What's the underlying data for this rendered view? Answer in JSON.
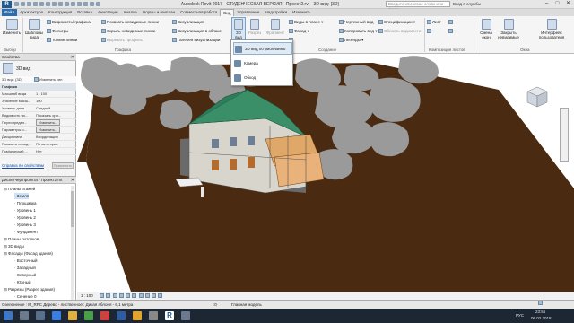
{
  "titlebar": {
    "logo": "R",
    "title": "Autodesk Revit 2017 - СТУДЕНЧЕСКАЯ ВЕРСИЯ -  Проект2.rvt - 3D вид: {3D}",
    "search_placeholder": "Введите ключевое слово или фразу",
    "user": "Вход в службы"
  },
  "tabs": [
    "Файл",
    "Архитектура",
    "Конструкция",
    "Вставка",
    "Аннотации",
    "Анализ",
    "Формы и генплан",
    "Совместная работа",
    "Вид",
    "Управление",
    "Надстройки",
    "Изменить"
  ],
  "active_tab": "Вид",
  "ribbon": {
    "modify": "Изменить",
    "filters": "Шаблоны вида",
    "visibility": "Видимость/ графика",
    "filters_btn": "Фильтры",
    "thin_lines": "Тонкие линии",
    "show_hidden": "Показать невидимые линии",
    "hide_hidden": "Скрыть невидимые линии",
    "cut_profile": "Вырезать профиль",
    "render": "Визуализация",
    "render_cloud": "Визуализация в облаке",
    "render_gallery": "Галерея визуализации",
    "view3d": "3D вид",
    "section": "Разрез",
    "callout": "Фрагмент",
    "plan_views": "Виды в плане",
    "elevation": "Фасад",
    "duplicate": "Копировать вид",
    "legends": "Легенды",
    "drafting": "Чертежный вид",
    "schedules": "Спецификации",
    "scope_box": "Область видимости",
    "sheet": "Лист",
    "title_block": "Основная надпись",
    "switch_windows": "Смена окон",
    "close_hidden": "Закрыть невидимые",
    "ui": "Интерфейс пользователя",
    "panel_select": "Выбор",
    "panel_graphics": "Графика",
    "panel_create": "Создание",
    "panel_sheets": "Композиция листов",
    "panel_windows": "Окна"
  },
  "dropdown": {
    "items": [
      "3D вид по умолчанию",
      "Камера",
      "Обход"
    ]
  },
  "properties": {
    "header": "Свойства",
    "type_name": "3D вид",
    "selector": "3D вид: {3D}",
    "edit_type": "Изменить тип",
    "section": "Графика",
    "rows": [
      {
        "k": "Масштаб вида",
        "v": "1 : 100"
      },
      {
        "k": "Значение масш...",
        "v": "100"
      },
      {
        "k": "Уровень дета...",
        "v": "Средний"
      },
      {
        "k": "Видимость ча...",
        "v": "Показать ори..."
      },
      {
        "k": "Переопредел...",
        "v": "Изменить..."
      },
      {
        "k": "Параметры о...",
        "v": "Изменить..."
      },
      {
        "k": "Дисциплина",
        "v": "Координация"
      },
      {
        "k": "Показать невид...",
        "v": "По категории"
      },
      {
        "k": "Графический ...",
        "v": "Нет"
      }
    ],
    "help_link": "Справка по свойствам",
    "apply": "Применить"
  },
  "browser": {
    "header": "Диспетчер проекта - Проект2.rvt",
    "nodes": [
      {
        "label": "Планы этажей",
        "level": 1
      },
      {
        "label": "Земля",
        "level": 2,
        "selected": true
      },
      {
        "label": "Площадка",
        "level": 2
      },
      {
        "label": "Уровень 1",
        "level": 2
      },
      {
        "label": "Уровень 2",
        "level": 2
      },
      {
        "label": "Уровень 3",
        "level": 2
      },
      {
        "label": "Фундамент",
        "level": 2
      },
      {
        "label": "Планы потолков",
        "level": 1
      },
      {
        "label": "3D виды",
        "level": 1
      },
      {
        "label": "Фасады (Фасад здания)",
        "level": 1
      },
      {
        "label": "Восточный",
        "level": 2
      },
      {
        "label": "Западный",
        "level": 2
      },
      {
        "label": "Северный",
        "level": 2
      },
      {
        "label": "Южный",
        "level": 2
      },
      {
        "label": "Разрезы (Разрез здания)",
        "level": 1
      },
      {
        "label": "Сечение 0",
        "level": 2
      }
    ]
  },
  "viewbar": {
    "scale": "1 : 100"
  },
  "statusbar": {
    "left": "Озеленение : M_RPC Дерево - лиственное : Дикая яблоня - 6,1 метра",
    "zero": ":0",
    "model": "Главная модель"
  },
  "taskbar": {
    "time": "23:56",
    "date": "06.02.2018",
    "lang": "РУС"
  },
  "colors": {
    "roof": "#2e7d5b",
    "ground": "#4a2a10",
    "trees": "#9a9a9a",
    "accent": "#2e6dad"
  }
}
